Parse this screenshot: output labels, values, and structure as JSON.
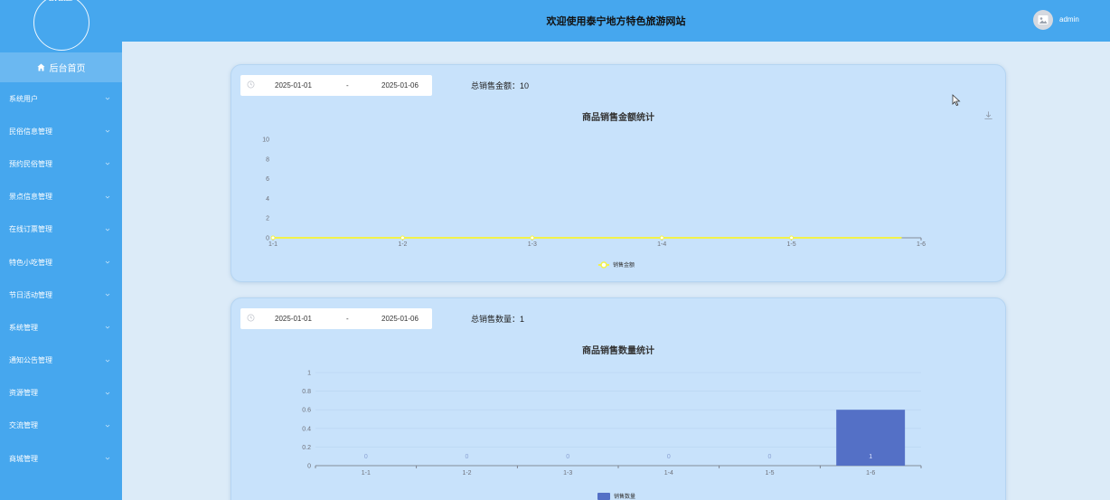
{
  "sidebar": {
    "avatar_text": "avatar",
    "home_label": "后台首页",
    "items": [
      {
        "label": "系统用户"
      },
      {
        "label": "民俗信息管理"
      },
      {
        "label": "预约民俗管理"
      },
      {
        "label": "景点信息管理"
      },
      {
        "label": "在线订票管理"
      },
      {
        "label": "特色小吃管理"
      },
      {
        "label": "节日活动管理"
      },
      {
        "label": "系统管理"
      },
      {
        "label": "通知公告管理"
      },
      {
        "label": "资源管理"
      },
      {
        "label": "交流管理"
      },
      {
        "label": "商城管理"
      }
    ]
  },
  "header": {
    "title": "欢迎使用泰宁地方特色旅游网站",
    "username": "admin"
  },
  "sales_amount": {
    "date_start": "2025-01-01",
    "date_separator": "-",
    "date_end": "2025-01-06",
    "total_label": "总销售金额：10"
  },
  "sales_count": {
    "date_start": "2025-01-01",
    "date_separator": "-",
    "date_end": "2025-01-06",
    "total_label": "总销售数量：1"
  },
  "colors": {
    "sidebar": "#46a7ee",
    "line_series": "#f2f24a",
    "bar_series": "#5470c6"
  },
  "chart_data": [
    {
      "type": "line",
      "title": "商品销售金额统计",
      "categories": [
        "1-1",
        "1-2",
        "1-3",
        "1-4",
        "1-5",
        "1-6"
      ],
      "series": [
        {
          "name": "销售金额",
          "values": [
            0,
            0,
            0,
            0,
            0,
            null
          ]
        }
      ],
      "ylim": [
        0,
        10
      ],
      "yticks": [
        0,
        2,
        4,
        6,
        8,
        10
      ],
      "grid": false,
      "legend": "bottom-center"
    },
    {
      "type": "bar",
      "title": "商品销售数量统计",
      "categories": [
        "1-1",
        "1-2",
        "1-3",
        "1-4",
        "1-5",
        "1-6"
      ],
      "series": [
        {
          "name": "销售数量",
          "values": [
            0,
            0,
            0,
            0,
            0,
            0.6
          ]
        }
      ],
      "data_labels": [
        "0",
        "0",
        "0",
        "0",
        "0",
        "1"
      ],
      "ylim": [
        0,
        1
      ],
      "yticks": [
        "0",
        "0.2",
        "0.4",
        "0.6",
        "0.8",
        "1"
      ],
      "grid": true,
      "legend": "bottom-center"
    }
  ]
}
